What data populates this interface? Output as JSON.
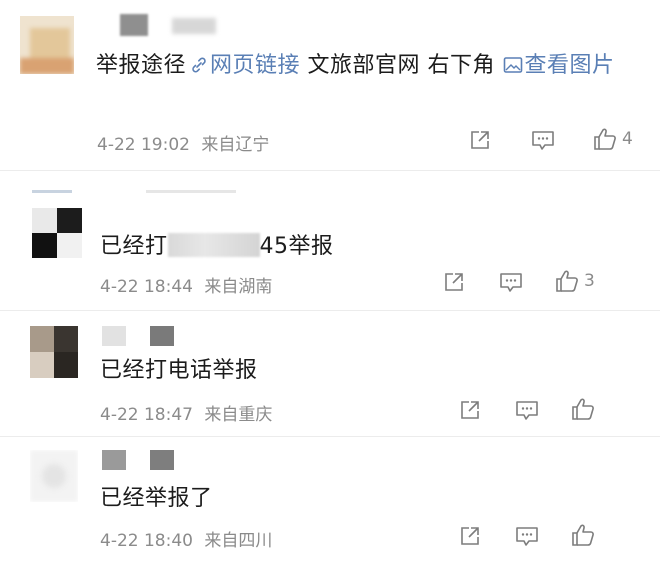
{
  "comments": [
    {
      "text_prefix": "举报途径",
      "link1": "网页链接",
      "mid_text": " 文旅部官网 右下角 ",
      "link2": "查看图片",
      "time": "4-22 19:02",
      "location": "来自辽宁",
      "likes": "4"
    },
    {
      "text_prefix": "已经打",
      "text_suffix": "45举报",
      "time": "4-22 18:44",
      "location": "来自湖南",
      "likes": "3"
    },
    {
      "text": "已经打电话举报",
      "time": "4-22 18:47",
      "location": "来自重庆",
      "likes": ""
    },
    {
      "text": "已经举报了",
      "time": "4-22 18:40",
      "location": "来自四川",
      "likes": ""
    }
  ],
  "icons": {
    "share": "share-icon",
    "comment": "comment-icon",
    "like": "thumbs-up-icon",
    "link": "link-icon",
    "image": "image-icon"
  },
  "colors": {
    "link": "#5a7fb5",
    "meta": "#8b8b8b",
    "text": "#1c1c1c"
  }
}
